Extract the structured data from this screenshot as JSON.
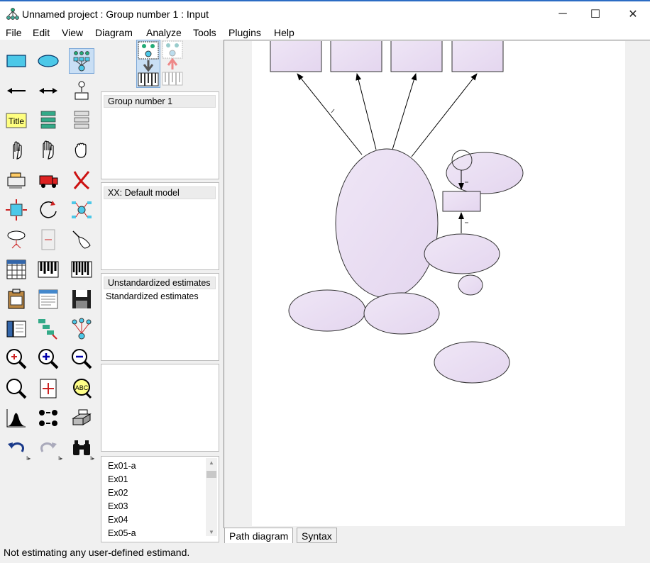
{
  "window": {
    "title": "Unnamed project : Group number 1 : Input",
    "minimize_glyph": "─",
    "maximize_glyph": "☐",
    "close_glyph": "✕"
  },
  "menu": [
    "File",
    "Edit",
    "View",
    "Diagram",
    "Analyze",
    "Tools",
    "Plugins",
    "Help"
  ],
  "panels": {
    "groups": {
      "items": [
        "Group number 1"
      ]
    },
    "models": {
      "items": [
        "XX: Default model"
      ]
    },
    "estimates": {
      "items": [
        "Unstandardized estimates",
        "Standardized estimates"
      ]
    },
    "files": {
      "items": [
        "Ex01-a",
        "Ex01",
        "Ex02",
        "Ex03",
        "Ex04",
        "Ex05-a"
      ]
    }
  },
  "toolbox": {
    "title_tool_label": "Title",
    "abc_label": "ABC"
  },
  "tabs": {
    "path_diagram": "Path diagram",
    "syntax": "Syntax"
  },
  "status": {
    "text": "Not estimating any user-defined estimand."
  },
  "colors": {
    "shape_fill": "#e9ddf2",
    "accent": "#2b6cc4"
  }
}
